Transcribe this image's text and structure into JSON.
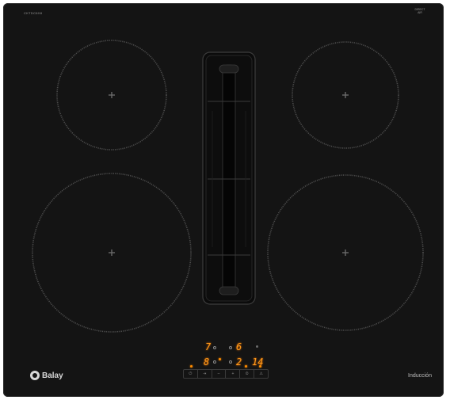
{
  "model_code": "CKTDC6X8",
  "top_logo_lines": [
    "DIRECT",
    "AIR"
  ],
  "brand": "Balay",
  "technology": "Inducción",
  "zones": [
    {
      "name": "front-left",
      "level": "7"
    },
    {
      "name": "front-right",
      "level": "6"
    },
    {
      "name": "rear-left",
      "level": "8"
    },
    {
      "name": "rear-right",
      "level": "2"
    },
    {
      "name": "timer",
      "level": "14"
    }
  ],
  "controls": {
    "keys": [
      "⏻",
      "⇥",
      "–",
      "+",
      "⏲",
      "⚠"
    ]
  },
  "colors": {
    "glass": "#141414",
    "display": "#ff9a1a",
    "markings": "#5a5a5a"
  }
}
